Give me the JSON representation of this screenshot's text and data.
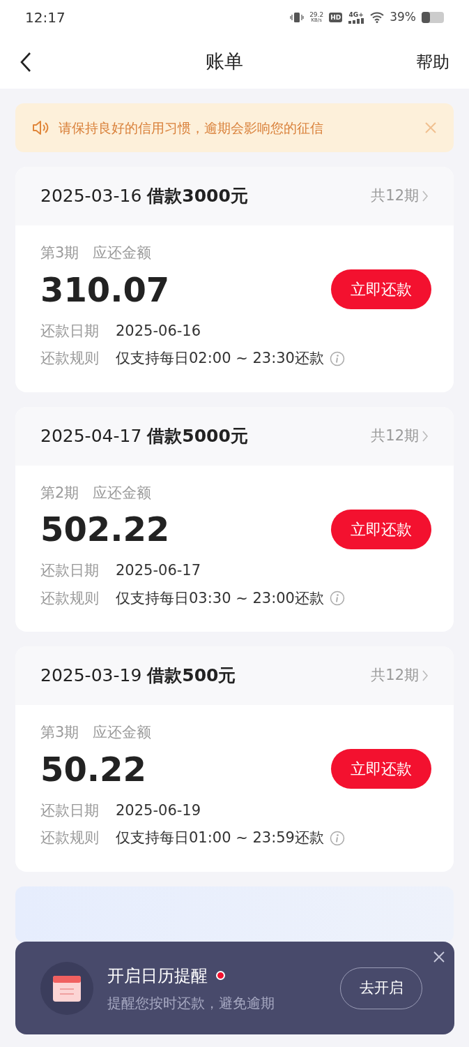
{
  "status_bar": {
    "time": "12:17",
    "speed_value": "29.2",
    "speed_unit": "KB/s",
    "hd": "HD",
    "network": "4G+",
    "battery": "39%"
  },
  "nav": {
    "title": "账单",
    "help": "帮助"
  },
  "notice": {
    "text": "请保持良好的信用习惯，逾期会影响您的征信"
  },
  "loans": [
    {
      "title": "2025-03-16 **借款3000元**",
      "periods": "共12期",
      "installment": "第3期",
      "due_label": "应还金额",
      "amount": "310.07",
      "button": "立即还款",
      "date_label": "还款日期",
      "date": "2025-06-16",
      "rule_label": "还款规则",
      "rule": "仅支持每日02:00 ~ 23:30还款"
    },
    {
      "title": "2025-04-17 **借款5000元**",
      "periods": "共12期",
      "installment": "第2期",
      "due_label": "应还金额",
      "amount": "502.22",
      "button": "立即还款",
      "date_label": "还款日期",
      "date": "2025-06-17",
      "rule_label": "还款规则",
      "rule": "仅支持每日03:30 ~ 23:00还款"
    },
    {
      "title": "2025-03-19 **借款500元**",
      "periods": "共12期",
      "installment": "第3期",
      "due_label": "应还金额",
      "amount": "50.22",
      "button": "立即还款",
      "date_label": "还款日期",
      "date": "2025-06-19",
      "rule_label": "还款规则",
      "rule": "仅支持每日01:00 ~ 23:59还款"
    }
  ],
  "reminder": {
    "title": "开启日历提醒",
    "unread": true,
    "subtitle": "提醒您按时还款，避免逾期",
    "button": "去开启"
  }
}
